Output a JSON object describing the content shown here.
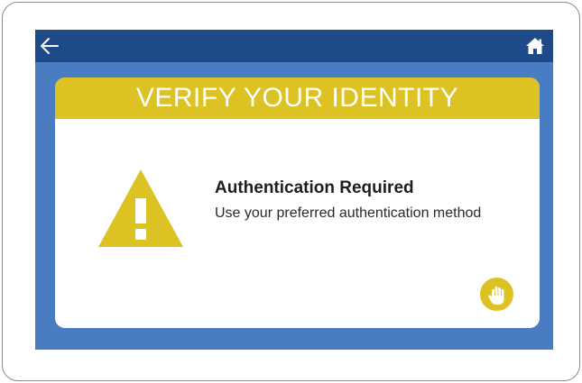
{
  "header": {
    "back_icon": "arrow-left-icon",
    "home_icon": "home-icon"
  },
  "card": {
    "title": "VERIFY YOUR IDENTITY",
    "warning_icon": "warning-triangle-icon",
    "message_title": "Authentication Required",
    "message_body": "Use your preferred authentication method",
    "action_icon": "hand-touch-icon"
  },
  "colors": {
    "top_bar": "#1f4a8a",
    "screen_background": "#4a7cc2",
    "accent_yellow": "#ddc223",
    "card_background": "#ffffff"
  }
}
